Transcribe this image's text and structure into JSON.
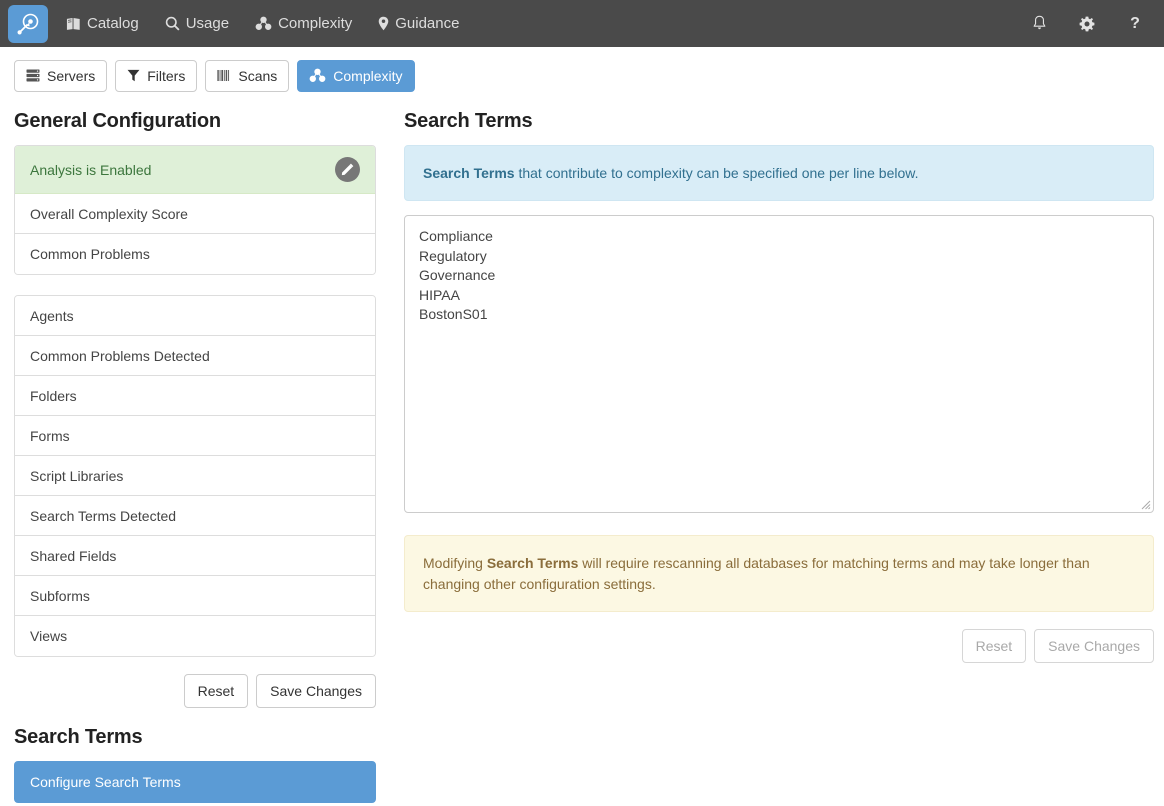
{
  "navbar": {
    "brand_icon": "search-target-logo-icon",
    "links": [
      {
        "label": "Catalog",
        "icon": "book-icon"
      },
      {
        "label": "Usage",
        "icon": "search-icon"
      },
      {
        "label": "Complexity",
        "icon": "cubes-icon"
      },
      {
        "label": "Guidance",
        "icon": "map-marker-icon"
      }
    ],
    "right_icons": [
      {
        "name": "bell-icon",
        "glyph": "☉"
      },
      {
        "name": "gear-icon",
        "glyph": "⚙"
      },
      {
        "name": "help-icon",
        "glyph": "?"
      }
    ],
    "background": "#4a4a4a",
    "brand_color": "#5b9bd5"
  },
  "toolbar": {
    "buttons": [
      {
        "label": "Servers",
        "icon": "server-icon",
        "active": false
      },
      {
        "label": "Filters",
        "icon": "filter-icon",
        "active": false
      },
      {
        "label": "Scans",
        "icon": "barcode-icon",
        "active": false
      },
      {
        "label": "Complexity",
        "icon": "cubes-icon",
        "active": true
      }
    ]
  },
  "left": {
    "title": "General Configuration",
    "status_group": [
      {
        "label": "Analysis is Enabled",
        "state": "success",
        "action_icon": "pencil-icon"
      },
      {
        "label": "Overall Complexity Score",
        "state": "default"
      },
      {
        "label": "Common Problems",
        "state": "default"
      }
    ],
    "metrics_group": [
      {
        "label": "Agents"
      },
      {
        "label": "Common Problems Detected"
      },
      {
        "label": "Folders"
      },
      {
        "label": "Forms"
      },
      {
        "label": "Script Libraries"
      },
      {
        "label": "Search Terms Detected"
      },
      {
        "label": "Shared Fields"
      },
      {
        "label": "Subforms"
      },
      {
        "label": "Views"
      }
    ],
    "reset_label": "Reset",
    "save_label": "Save Changes",
    "search_terms_title": "Search Terms",
    "configure_button_label": "Configure Search Terms"
  },
  "right": {
    "title": "Search Terms",
    "info_alert": {
      "bold": "Search Terms",
      "rest": " that contribute to complexity can be specified one per line below."
    },
    "textarea": {
      "value": "Compliance\nRegulatory\nGovernance\nHIPAA\nBostonS01",
      "placeholder": ""
    },
    "warning_alert": {
      "lead": "Modifying ",
      "bold": "Search Terms",
      "rest": " will require rescanning all databases for matching terms and may take longer than changing other configuration settings."
    },
    "reset_label": "Reset",
    "save_label": "Save Changes"
  },
  "colors": {
    "accent": "#5b9bd5",
    "navbar": "#4a4a4a",
    "success_bg": "#dff0d8",
    "success_text": "#3c763d",
    "info_bg": "#d9edf7",
    "info_text": "#31708f",
    "warning_bg": "#fcf8e3",
    "warning_text": "#8a6d3b"
  }
}
